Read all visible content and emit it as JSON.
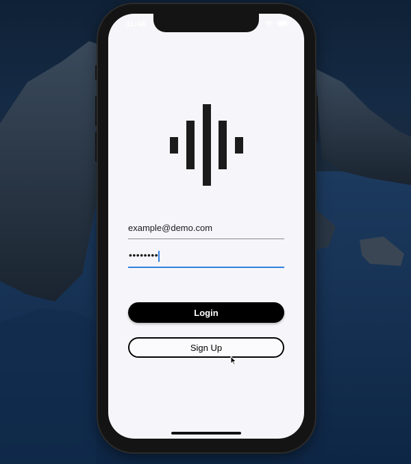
{
  "status_bar": {
    "time": "11:46"
  },
  "icons": {
    "logo": "soundwave-logo-icon",
    "wifi": "wifi-icon",
    "battery": "battery-icon",
    "cursor": "mouse-pointer-icon"
  },
  "login_form": {
    "email_value": "example@demo.com",
    "password_masked": "••••••••"
  },
  "buttons": {
    "login_label": "Login",
    "signup_label": "Sign Up"
  },
  "colors": {
    "accent": "#2f7fe0",
    "primary_button": "#000000",
    "screen_background": "#f6f5f9"
  }
}
